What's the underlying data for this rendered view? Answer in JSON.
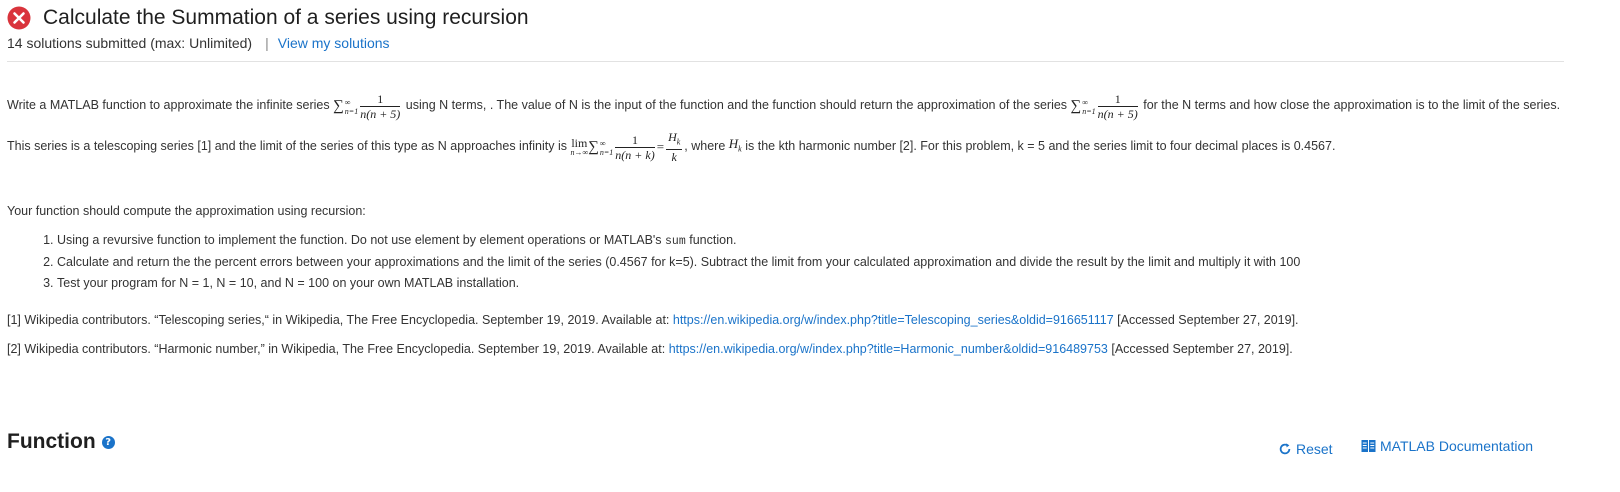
{
  "header": {
    "title": "Calculate the Summation of a series using recursion",
    "submissions": "14 solutions submitted (max: Unlimited)",
    "separator": "|",
    "view_solutions": "View my solutions",
    "status_icon": "error-x-circle-icon",
    "status_color": "#d9343c"
  },
  "problem": {
    "p1_a": "Write a MATLAB function to approximate the infinite series",
    "p1_b": "using N terms, . The value of N is the input of the function and the function should return the approximation of the series",
    "p1_c": "for the N terms and how close the approximation is to the limit of the series. This series is a telescoping series [1] and the limit of the series of this type as N approaches infinity is",
    "p1_d": ", where",
    "p1_e": "is the kth harmonic number [2]. For this problem, k = 5 and the series limit to four decimal places is 0.4567.",
    "math": {
      "sum_symbol": "∑",
      "upper": "∞",
      "lower": "n=1",
      "one": "1",
      "den_n5": "n(n + 5)",
      "den_nk": "n(n + k)",
      "lim_word": "lim",
      "lim_sub": "n→∞",
      "equals": "=",
      "h_k": "H",
      "k_sub": "k",
      "k": "k"
    },
    "p2": "Your function should compute the approximation using recursion:",
    "steps": [
      {
        "a": "Using a revursive function to implement the function. Do not use element by element operations or MATLAB's",
        "code": "sum",
        "b": "function."
      },
      {
        "a": "Calculate and return the the percent errors between your approximations and the limit of the series (0.4567 for k=5). Subtract the limit from your calculated approximation and divide the result by the limit and multiply it with 100"
      },
      {
        "a": "Test your program for N = 1, N = 10, and N = 100 on your own MATLAB installation."
      }
    ],
    "refs": [
      {
        "text": "[1] Wikipedia contributors. “Telescoping series,“ in Wikipedia, The Free Encyclopedia. September 19, 2019. Available at:",
        "link": "https://en.wikipedia.org/w/index.php?title=Telescoping_series&oldid=916651117",
        "tail": "[Accessed September 27, 2019]."
      },
      {
        "text": "[2] Wikipedia contributors. “Harmonic number,” in Wikipedia, The Free Encyclopedia. September 19, 2019. Available at:",
        "link": "https://en.wikipedia.org/w/index.php?title=Harmonic_number&oldid=916489753",
        "tail": "[Accessed September 27, 2019]."
      }
    ]
  },
  "function_section": {
    "title": "Function",
    "help_icon": "question-circle-icon",
    "help_glyph": "?",
    "reset_label": "Reset",
    "reset_icon": "refresh-icon",
    "doc_label": "MATLAB Documentation",
    "doc_icon": "book-icon",
    "link_color": "#1a73c9"
  }
}
